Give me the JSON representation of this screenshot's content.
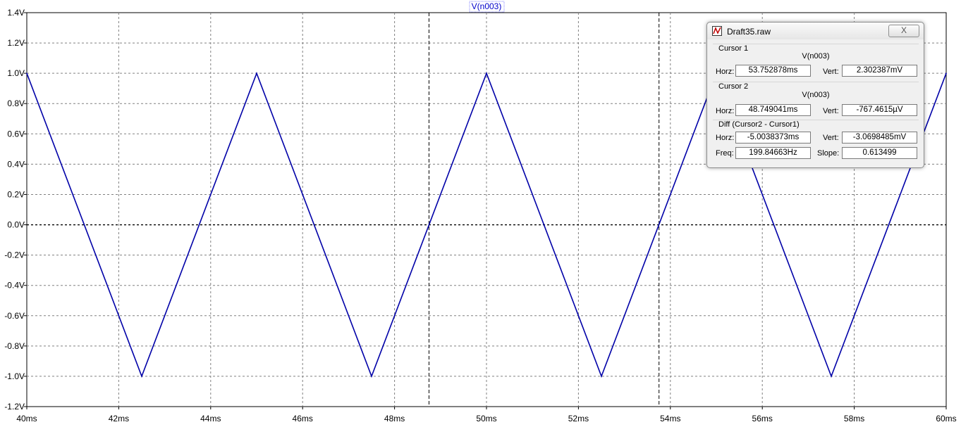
{
  "chart_data": {
    "type": "line",
    "title": "V(n003)",
    "xlabel": "",
    "ylabel": "",
    "xlim": [
      40,
      60
    ],
    "ylim": [
      -1.2,
      1.4
    ],
    "grid": true,
    "x_ticks": [
      "40ms",
      "42ms",
      "44ms",
      "46ms",
      "48ms",
      "50ms",
      "52ms",
      "54ms",
      "56ms",
      "58ms",
      "60ms"
    ],
    "y_ticks": [
      "1.4V",
      "1.2V",
      "1.0V",
      "0.8V",
      "0.6V",
      "0.4V",
      "0.2V",
      "0.0V",
      "-0.2V",
      "-0.4V",
      "-0.6V",
      "-0.8V",
      "-1.0V",
      "-1.2V"
    ],
    "series": [
      {
        "name": "V(n003)",
        "color": "#0000a8",
        "x": [
          40,
          42.5,
          45,
          47.5,
          50,
          52.5,
          55,
          57.5,
          60
        ],
        "y": [
          1.0,
          -1.0,
          1.0,
          -1.0,
          1.0,
          -1.0,
          1.0,
          -1.0,
          1.0
        ]
      }
    ],
    "cursors": [
      48.749041,
      53.752878
    ]
  },
  "cursor_window": {
    "title": "Draft35.raw",
    "close_label": "X",
    "cursor1": {
      "label": "Cursor 1",
      "trace": "V(n003)",
      "horz_label": "Horz:",
      "horz": "53.752878ms",
      "vert_label": "Vert:",
      "vert": "2.302387mV"
    },
    "cursor2": {
      "label": "Cursor 2",
      "trace": "V(n003)",
      "horz_label": "Horz:",
      "horz": "48.749041ms",
      "vert_label": "Vert:",
      "vert": "-767.4615µV"
    },
    "diff": {
      "label": "Diff (Cursor2 - Cursor1)",
      "horz_label": "Horz:",
      "horz": "-5.0038373ms",
      "vert_label": "Vert:",
      "vert": "-3.0698485mV",
      "freq_label": "Freq:",
      "freq": "199.84663Hz",
      "slope_label": "Slope:",
      "slope": "0.613499"
    }
  }
}
